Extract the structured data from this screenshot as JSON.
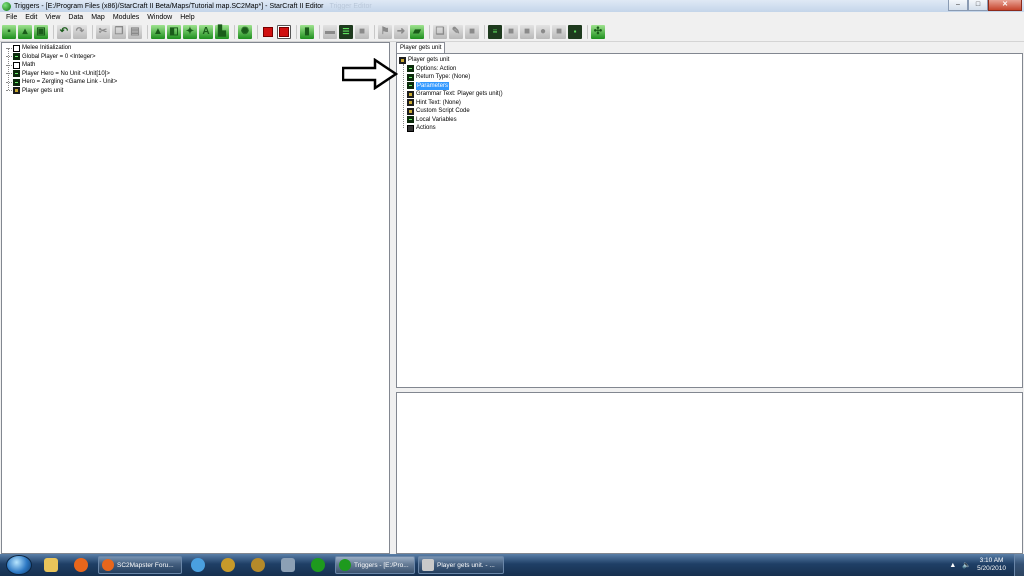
{
  "window": {
    "title": "Triggers - [E:/Program Files (x86)/StarCraft II Beta/Maps/Tutorial map.SC2Map*] - StarCraft II Editor",
    "title_ghost": "Trigger Editor",
    "minimize": "–",
    "maximize": "□",
    "close": "✕"
  },
  "menu": [
    "File",
    "Edit",
    "View",
    "Data",
    "Map",
    "Modules",
    "Window",
    "Help"
  ],
  "left_tree": [
    {
      "label": "Melee Initialization",
      "icon": "doc-icon"
    },
    {
      "label": "Global Player = 0 <Integer>",
      "icon": "variable-icon"
    },
    {
      "label": "Math",
      "icon": "doc-icon"
    },
    {
      "label": "Player Hero = No Unit <Unit[10]>",
      "icon": "variable-icon"
    },
    {
      "label": "Hero = Zergling <Game Link - Unit>",
      "icon": "variable-icon"
    },
    {
      "label": "Player gets unit",
      "icon": "function-icon"
    }
  ],
  "tab": {
    "label": "Player gets unit"
  },
  "right_tree": {
    "root": "Player gets unit",
    "children": [
      {
        "label": "Options: Action",
        "icon": "variable-icon"
      },
      {
        "label": "Return Type: (None)",
        "icon": "variable-icon"
      },
      {
        "label": "Parameters",
        "icon": "variable-icon",
        "selected": true
      },
      {
        "label": "Grammar Text: Player gets unit()",
        "icon": "trigger-icon"
      },
      {
        "label": "Hint Text: (None)",
        "icon": "trigger-icon"
      },
      {
        "label": "Custom Script Code",
        "icon": "trigger-icon"
      },
      {
        "label": "Local Variables",
        "icon": "variable-icon"
      },
      {
        "label": "Actions",
        "icon": "folder-icon"
      }
    ]
  },
  "taskbar": {
    "buttons": [
      {
        "label": "SC2Mapster Foru...",
        "icon_color": "#e8661c"
      },
      {
        "label": "Triggers - [E:/Pro...",
        "icon_color": "#1e9a1e",
        "active": true
      },
      {
        "label": "Player gets unit. - ...",
        "icon_color": "#c9c9c9"
      }
    ],
    "pinned": [
      {
        "name": "explorer-icon",
        "color": "#e9c45a"
      },
      {
        "name": "firefox-icon",
        "color": "#e8661c"
      },
      {
        "name": "sync-icon",
        "color": "#4aa0e0"
      },
      {
        "name": "warcraft-icon",
        "color": "#c79a2a"
      },
      {
        "name": "hon-icon",
        "color": "#b58a2a"
      },
      {
        "name": "starcraft-icon",
        "color": "#8ca0b5"
      },
      {
        "name": "sc2-editor-icon",
        "color": "#1e9a1e"
      }
    ],
    "time": "3:10 AM",
    "date": "5/20/2010"
  }
}
